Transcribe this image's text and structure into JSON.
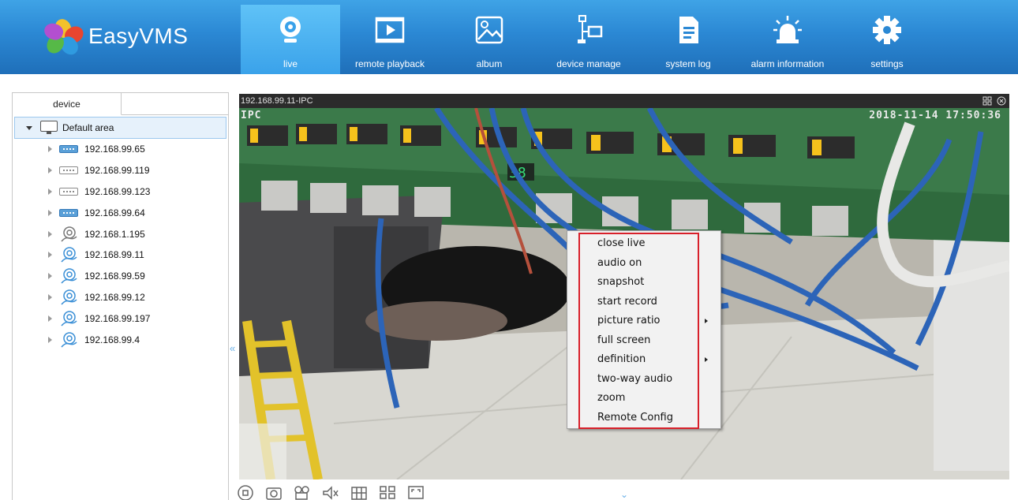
{
  "app": {
    "name": "EasyVMS"
  },
  "nav": [
    {
      "label": "live",
      "icon": "webcam-icon",
      "active": true
    },
    {
      "label": "remote playback",
      "icon": "playback-icon",
      "active": false
    },
    {
      "label": "album",
      "icon": "image-icon",
      "active": false
    },
    {
      "label": "device manage",
      "icon": "device-manage-icon",
      "active": false
    },
    {
      "label": "system log",
      "icon": "document-icon",
      "active": false
    },
    {
      "label": "alarm information",
      "icon": "alarm-light-icon",
      "active": false
    },
    {
      "label": "settings",
      "icon": "gear-icon",
      "active": false
    }
  ],
  "device_panel": {
    "tab_label": "device",
    "root": {
      "label": "Default area",
      "icon": "monitor-icon"
    },
    "items": [
      {
        "label": "192.168.99.65",
        "icon": "nvr-icon",
        "status": "online"
      },
      {
        "label": "192.168.99.119",
        "icon": "nvr-icon",
        "status": "offline"
      },
      {
        "label": "192.168.99.123",
        "icon": "nvr-icon",
        "status": "offline"
      },
      {
        "label": "192.168.99.64",
        "icon": "nvr-icon",
        "status": "online"
      },
      {
        "label": "192.168.1.195",
        "icon": "ip-camera-icon",
        "status": "offline"
      },
      {
        "label": "192.168.99.11",
        "icon": "ip-camera-icon",
        "status": "online"
      },
      {
        "label": "192.168.99.59",
        "icon": "ip-camera-icon",
        "status": "online"
      },
      {
        "label": "192.168.99.12",
        "icon": "ip-camera-icon",
        "status": "online"
      },
      {
        "label": "192.168.99.197",
        "icon": "ip-camera-icon",
        "status": "online"
      },
      {
        "label": "192.168.99.4",
        "icon": "ip-camera-icon",
        "status": "online"
      }
    ]
  },
  "video": {
    "title": "192.168.99.11-IPC",
    "osd_name": "IPC",
    "osd_time": "2018-11-14 17:50:36"
  },
  "context_menu": {
    "items": [
      {
        "label": "close live",
        "submenu": false
      },
      {
        "label": "audio on",
        "submenu": false
      },
      {
        "label": "snapshot",
        "submenu": false
      },
      {
        "label": "start record",
        "submenu": false
      },
      {
        "label": "picture ratio",
        "submenu": true
      },
      {
        "label": "full screen",
        "submenu": false
      },
      {
        "label": "definition",
        "submenu": true
      },
      {
        "label": "two-way audio",
        "submenu": false
      },
      {
        "label": "zoom",
        "submenu": false
      },
      {
        "label": "Remote Config",
        "submenu": false
      }
    ]
  },
  "colors": {
    "topbar": "#2b88d4",
    "active_nav": "#4bb3f0",
    "highlight_box": "#d8202a",
    "online_device": "#5aa0d8"
  }
}
